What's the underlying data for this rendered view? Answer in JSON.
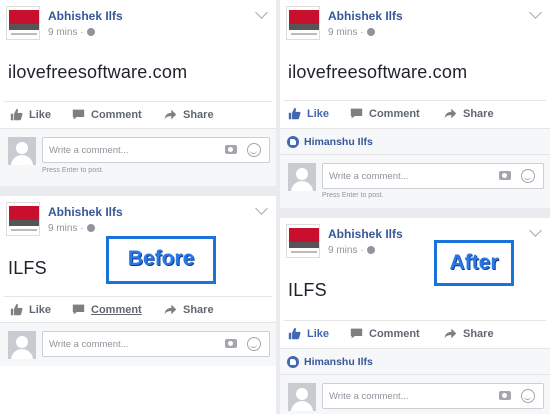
{
  "post": {
    "author": "Abhishek Ilfs",
    "time": "9 mins",
    "first_text": "ilovefreesoftware.com",
    "second_text": "ILFS"
  },
  "actions": {
    "like": "Like",
    "comment": "Comment",
    "share": "Share"
  },
  "comment_box": {
    "placeholder": "Write a comment...",
    "hint": "Press Enter to post."
  },
  "liker": "Himanshu Ilfs",
  "labels": {
    "before": "Before",
    "after": "After"
  },
  "colors": {
    "brand_blue": "#4267b2",
    "name_blue": "#365899",
    "label_blue": "#2b78e4"
  }
}
